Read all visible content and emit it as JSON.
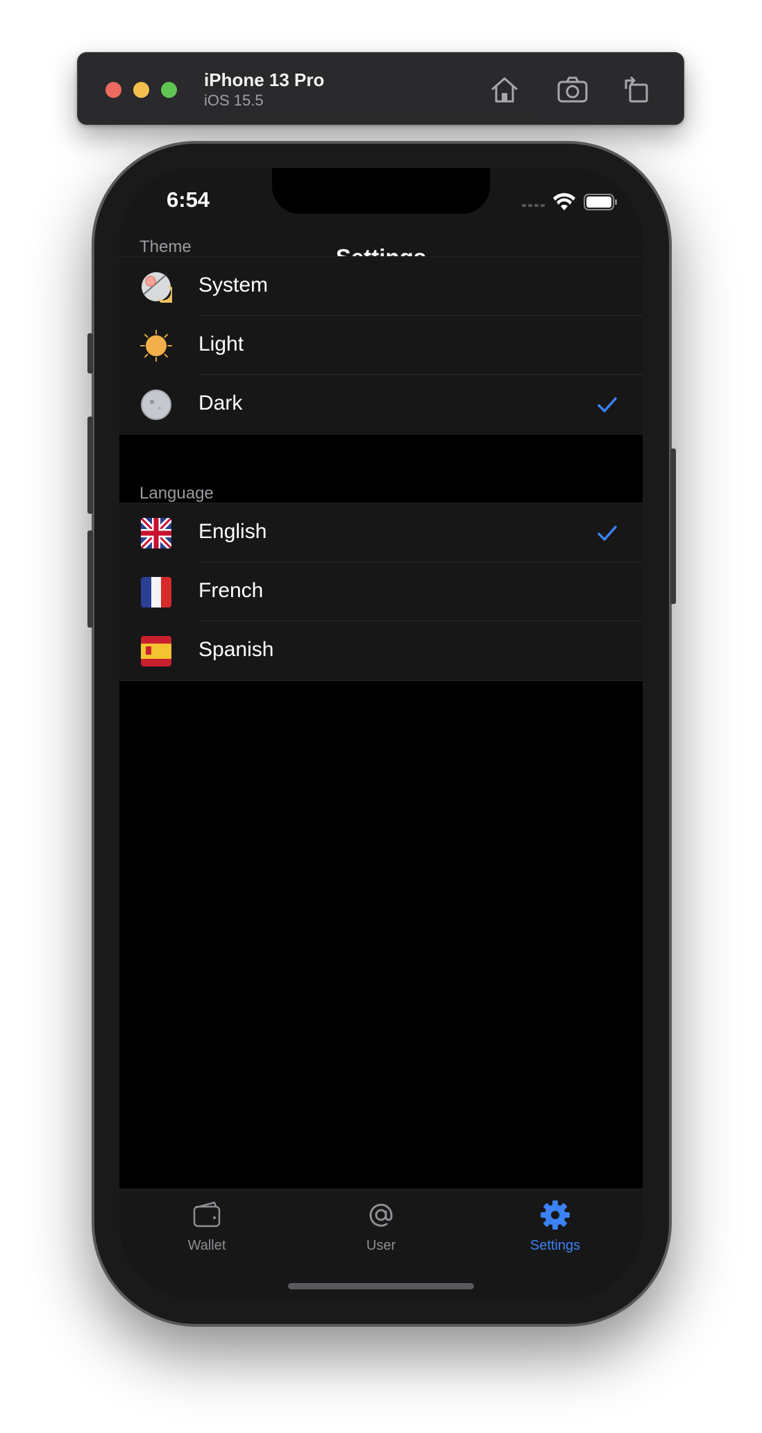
{
  "simulator": {
    "device_name": "iPhone 13 Pro",
    "os_version": "iOS 15.5",
    "icons": [
      "home-icon",
      "screenshot-icon",
      "rotate-icon"
    ]
  },
  "status_bar": {
    "time": "6:54"
  },
  "nav": {
    "title": "Settings"
  },
  "theme": {
    "header": "Theme",
    "items": [
      {
        "label": "System",
        "icon": "system-theme-icon",
        "selected": false
      },
      {
        "label": "Light",
        "icon": "sun-icon",
        "selected": false
      },
      {
        "label": "Dark",
        "icon": "moon-icon",
        "selected": true
      }
    ]
  },
  "language": {
    "header": "Language",
    "items": [
      {
        "label": "English",
        "icon": "uk-flag-icon",
        "selected": true
      },
      {
        "label": "French",
        "icon": "france-flag-icon",
        "selected": false
      },
      {
        "label": "Spanish",
        "icon": "spain-flag-icon",
        "selected": false
      }
    ]
  },
  "tabbar": {
    "tabs": [
      {
        "label": "Wallet",
        "icon": "wallet-icon",
        "active": false
      },
      {
        "label": "User",
        "icon": "at-sign-icon",
        "active": false
      },
      {
        "label": "Settings",
        "icon": "gear-icon",
        "active": true
      }
    ]
  },
  "colors": {
    "accent": "#3b82f6",
    "background": "#000000",
    "cell": "#171718"
  }
}
